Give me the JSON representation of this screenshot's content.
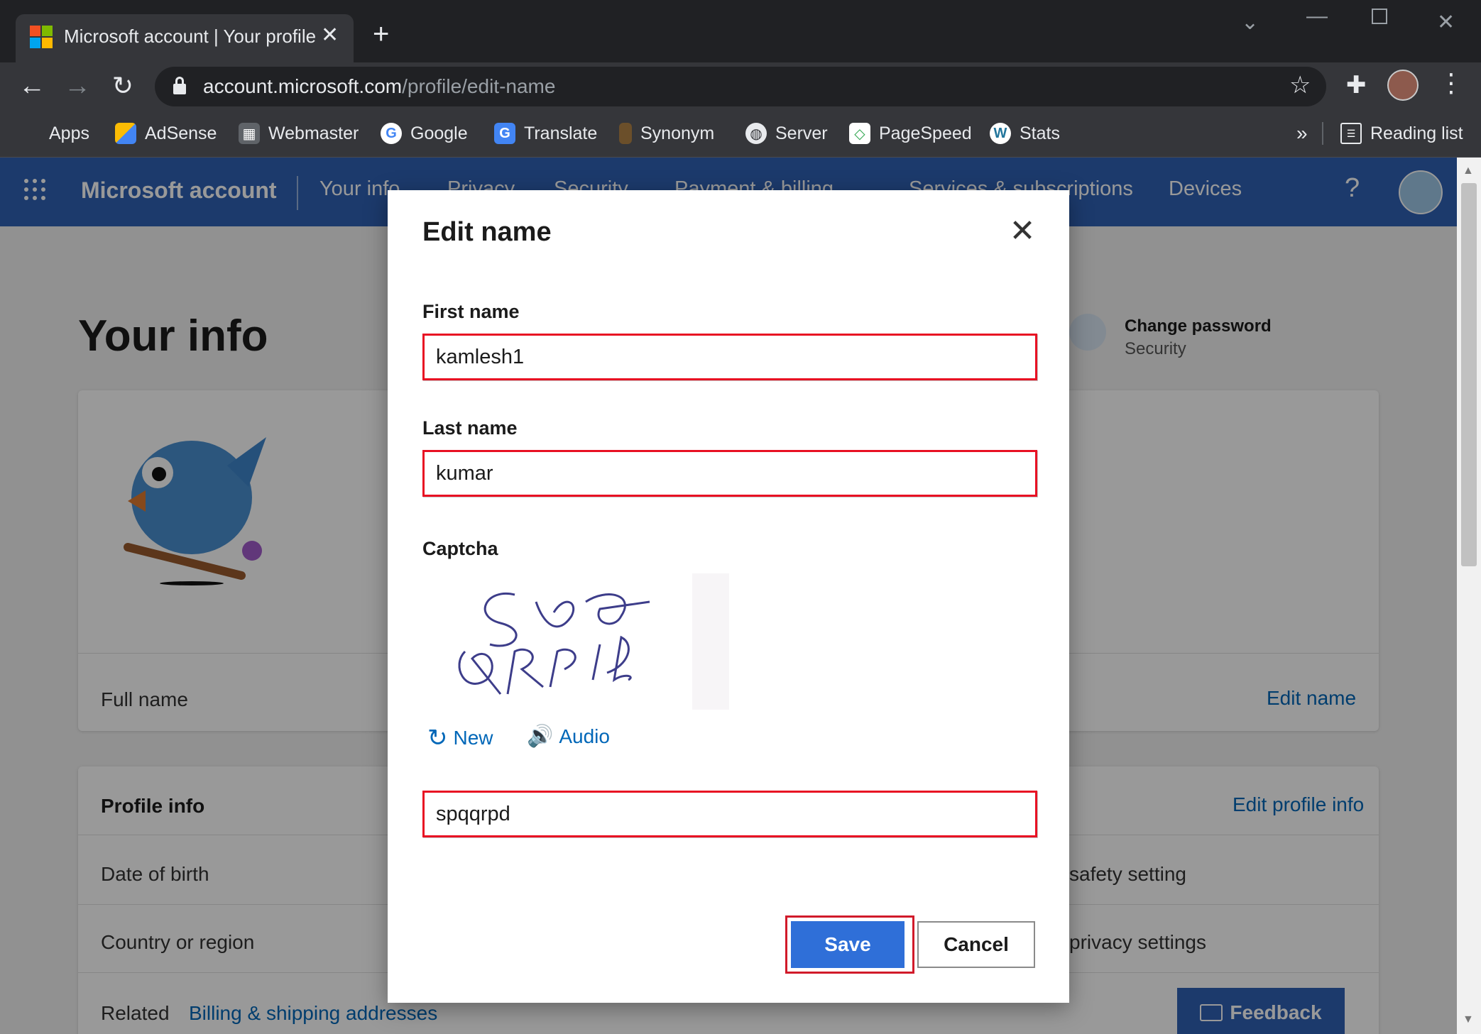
{
  "browser": {
    "tab_title": "Microsoft account | Your profile",
    "url_domain": "account.microsoft.com",
    "url_path": "/profile/edit-name",
    "bookmarks": [
      "Apps",
      "AdSense",
      "Webmaster",
      "Google",
      "Translate",
      "Synonym",
      "Server",
      "PageSpeed",
      "Stats"
    ],
    "reading_list": "Reading list",
    "overflow": "»"
  },
  "msnav": {
    "brand": "Microsoft account",
    "items": [
      "Your info",
      "Privacy",
      "Security",
      "Payment & billing",
      "Services & subscriptions",
      "Devices"
    ],
    "help": "?"
  },
  "page": {
    "title": "Your info",
    "change_password": "Change password",
    "security": "Security",
    "full_name_label": "Full name",
    "edit_name_link": "Edit name",
    "profile_info_heading": "Profile info",
    "edit_profile_info_link": "Edit profile info",
    "rows": [
      "Date of birth",
      "Country or region"
    ],
    "right_rows": [
      "safety setting",
      "privacy settings"
    ],
    "related_label": "Related",
    "related_link": "Billing & shipping addresses",
    "feedback": "Feedback"
  },
  "dialog": {
    "title": "Edit name",
    "first_name_label": "First name",
    "first_name_value": "kamlesh1",
    "last_name_label": "Last name",
    "last_name_value": "kumar",
    "captcha_label": "Captcha",
    "captcha_new": "New",
    "captcha_audio": "Audio",
    "captcha_value": "spqqrpd",
    "save": "Save",
    "cancel": "Cancel"
  },
  "colors": {
    "ms_blue": "#2f62b4",
    "link": "#0067b8",
    "highlight": "#e81123",
    "save_button": "#2f6fd8"
  }
}
